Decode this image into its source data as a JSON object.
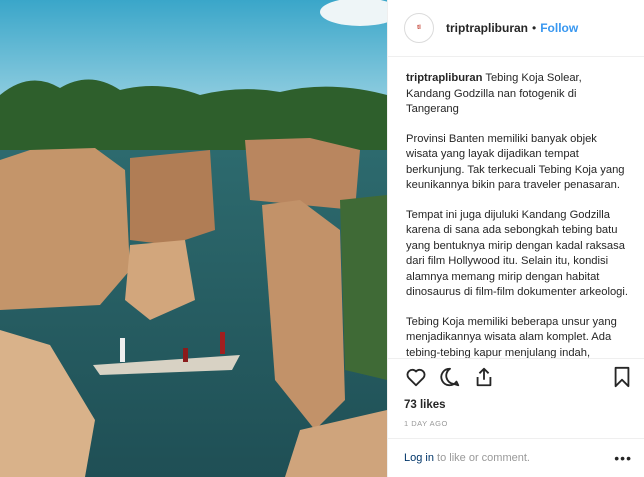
{
  "post": {
    "username": "triptrapliburan",
    "follow_label": "Follow",
    "separator": "•",
    "avatar_text": "tl",
    "caption": {
      "author": "triptrapliburan",
      "lead": "Tebing Koja Solear, Kandang Godzilla nan fotogenik di Tangerang",
      "p1": "Provinsi Banten memiliki banyak objek wisata yang layak dijadikan tempat berkunjung. Tak terkecuali Tebing Koja yang keunikannya bikin para traveler penasaran.",
      "p2": "Tempat ini juga dijuluki Kandang Godzilla karena di sana ada sebongkah tebing batu yang bentuknya mirip dengan kadal raksasa dari film Hollywood itu. Selain itu, kondisi alamnya memang mirip dengan habitat dinosaurus di film-film dokumenter arkeologi.",
      "p3": "Tebing Koja memiliki beberapa unsur yang menjadikannya wisata alam komplet. Ada tebing-tebing kapur menjulang indah,"
    },
    "icons": [
      "heart-icon",
      "comment-icon",
      "share-icon",
      "bookmark-icon"
    ],
    "likes": "73 likes",
    "time_ago": "1 DAY AGO",
    "comment_bar": {
      "login_label": "Log in",
      "rest_label": "to like or comment.",
      "more_label": "•••"
    }
  }
}
